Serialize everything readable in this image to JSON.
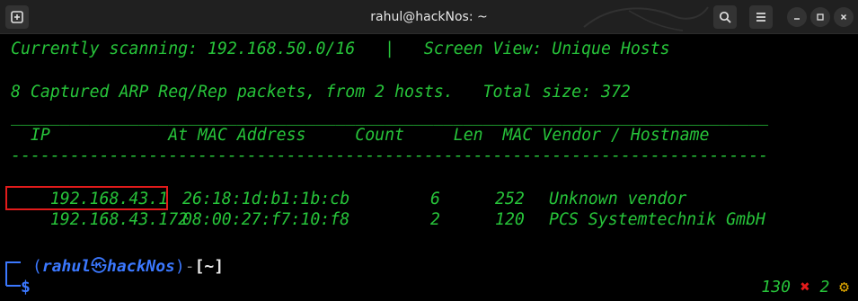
{
  "window": {
    "title": "rahul@hackNos: ~"
  },
  "terminal": {
    "lines": {
      "scanning": "Currently scanning: 192.168.50.0/16   |   Screen View: Unique Hosts",
      "captured": "8 Captured ARP Req/Rep packets, from 2 hosts.   Total size: 372",
      "sep_top": "_____________________________________________________________________________",
      "header": "  IP            At MAC Address     Count     Len  MAC Vendor / Hostname",
      "sep_bottom": "-----------------------------------------------------------------------------"
    },
    "hosts": [
      {
        "ip": "192.168.43.1",
        "mac": "26:18:1d:b1:1b:cb",
        "count": "6",
        "len": "252",
        "vendor": "Unknown vendor"
      },
      {
        "ip": "192.168.43.172",
        "mac": "08:00:27:f7:10:f8",
        "count": "2",
        "len": "120",
        "vendor": "PCS Systemtechnik GmbH"
      }
    ],
    "prompt": {
      "open_paren": "(",
      "user": "rahul",
      "skull": "㉿",
      "host": "hackNos",
      "close_paren": ")",
      "dash": "-",
      "dir": "[~]",
      "dollar": "$"
    },
    "status": {
      "exit_code": "130",
      "x_mark": "✖",
      "jobs": "2",
      "gear_icon": "⚙"
    }
  },
  "colors": {
    "terminal_text": "#27c43a",
    "prompt_blue": "#3b78ff",
    "highlight_red": "#e21b1b"
  }
}
